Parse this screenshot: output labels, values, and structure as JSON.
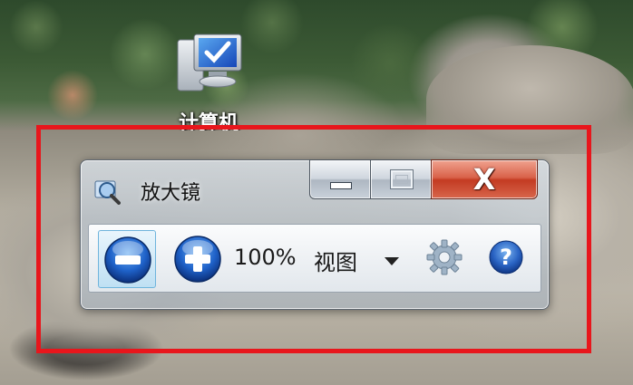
{
  "desktop": {
    "icon": {
      "name": "computer-icon",
      "label": "计算机"
    }
  },
  "window": {
    "title": "放大镜",
    "title_icon": "magnifier-icon",
    "caption_buttons": {
      "minimize_icon": "minimize-icon",
      "maximize_icon": "maximize-icon",
      "close_glyph": "X"
    }
  },
  "toolbar": {
    "zoom_out_icon": "zoom-out-icon",
    "zoom_in_icon": "zoom-in-icon",
    "zoom_level": "100%",
    "view_label": "视图",
    "view_dropdown_icon": "chevron-down-icon",
    "options_icon": "gear-icon",
    "help_icon": "help-icon"
  },
  "colors": {
    "highlight": "#e8161c",
    "close_button": "#c33b22",
    "button_blue": "#1f62c9"
  }
}
